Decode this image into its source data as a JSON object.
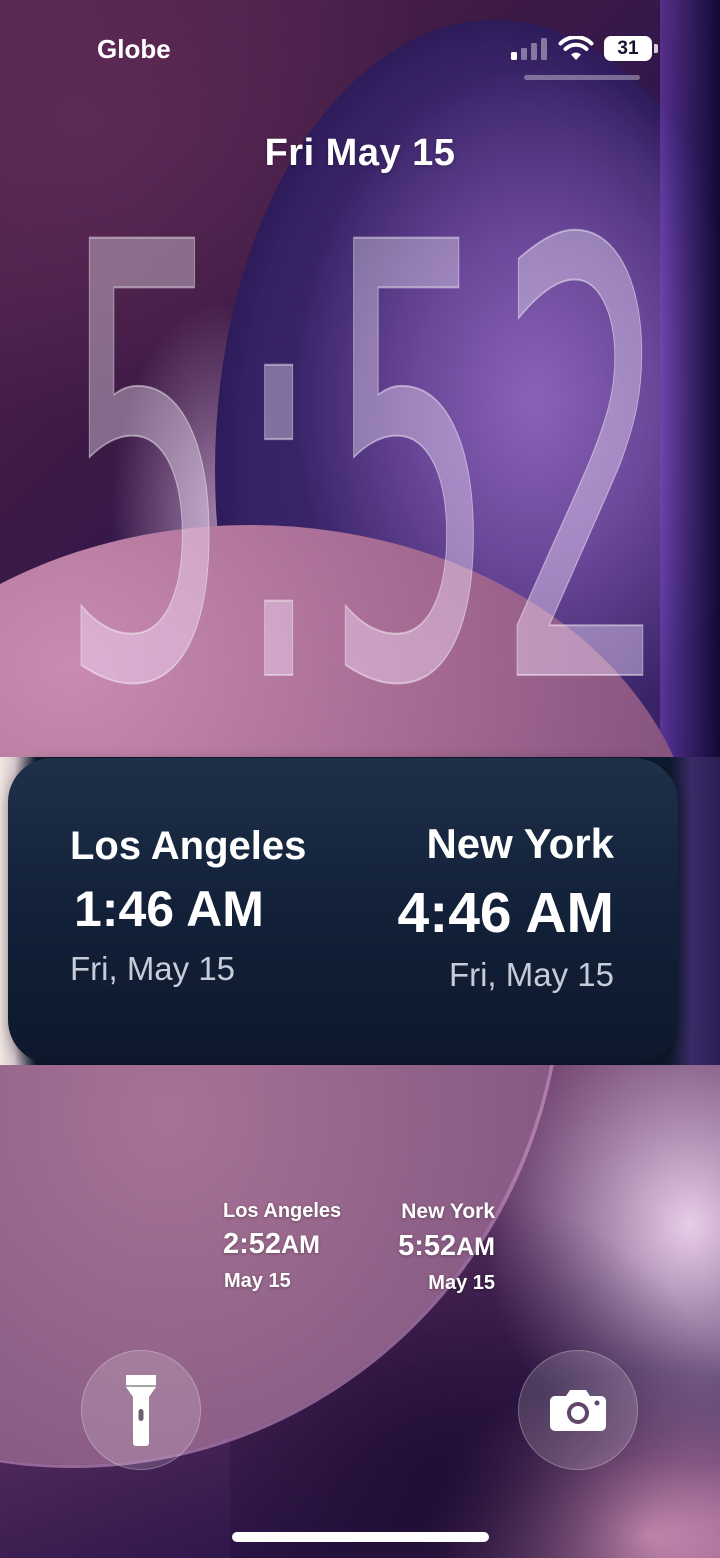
{
  "status_bar": {
    "carrier": "Globe",
    "battery_level": "31",
    "icons": [
      "signal-icon",
      "wifi-icon",
      "battery-icon"
    ]
  },
  "lock_screen": {
    "date": "Fri May 15",
    "time": "5:52"
  },
  "world_clock_widget_large": {
    "cities": [
      {
        "city": "Los Angeles",
        "time": "1:46 AM",
        "date": "Fri, May 15"
      },
      {
        "city": "New York",
        "time": "4:46 AM",
        "date": "Fri, May 15"
      }
    ]
  },
  "world_clock_widget_small": {
    "cities": [
      {
        "city": "Los Angeles",
        "time": "2:52",
        "ampm": "AM",
        "date": "May 15"
      },
      {
        "city": "New York",
        "time": "5:52",
        "ampm": "AM",
        "date": "May 15"
      }
    ]
  },
  "quick_actions": {
    "left_icon": "flashlight-icon",
    "right_icon": "camera-icon"
  },
  "colors": {
    "widget_background": "#13223a",
    "text": "#ffffff",
    "secondary_text": "#c6ccd8"
  }
}
